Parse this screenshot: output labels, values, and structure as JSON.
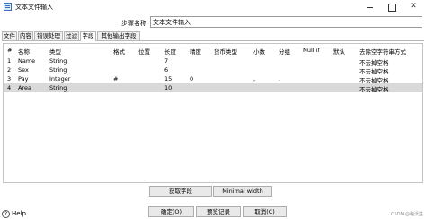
{
  "window": {
    "title": "文本文件输入",
    "close_glyph": "✕"
  },
  "step": {
    "label": "步骤名称",
    "value": "文本文件输入"
  },
  "tabs": [
    {
      "label": "文件"
    },
    {
      "label": "内容"
    },
    {
      "label": "错误处理"
    },
    {
      "label": "过滤"
    },
    {
      "label": "字段",
      "active": true
    },
    {
      "label": "其他输出字段"
    }
  ],
  "table": {
    "columns": [
      "#",
      "名称",
      "类型",
      "格式",
      "位置",
      "长度",
      "精度",
      "货币类型",
      "小数",
      "分组",
      "Null if",
      "默认",
      "去除空字符串方式"
    ],
    "rows": [
      [
        "1",
        "Name",
        "String",
        "",
        "",
        "7",
        "",
        "",
        "",
        "",
        "",
        "",
        "不去掉空格"
      ],
      [
        "2",
        "Sex",
        "String",
        "",
        "",
        "6",
        "",
        "",
        "",
        "",
        "",
        "",
        "不去掉空格"
      ],
      [
        "3",
        "Pay",
        "Integer",
        "#",
        "",
        "15",
        "0",
        "",
        ",",
        ".",
        "",
        "",
        "不去掉空格"
      ],
      [
        "4",
        "Area",
        "String",
        "",
        "",
        "10",
        "",
        "",
        "",
        "",
        "",
        "",
        "不去掉空格"
      ]
    ],
    "selected_row": 4
  },
  "buttons": {
    "get_fields": "获取字段",
    "minimal_width": "Minimal width",
    "ok": "确定(O)",
    "preview": "预览记录",
    "cancel": "取消(C)"
  },
  "help": {
    "label": "Help",
    "icon": "help-icon"
  },
  "watermark": "CSDN @稻沃生"
}
